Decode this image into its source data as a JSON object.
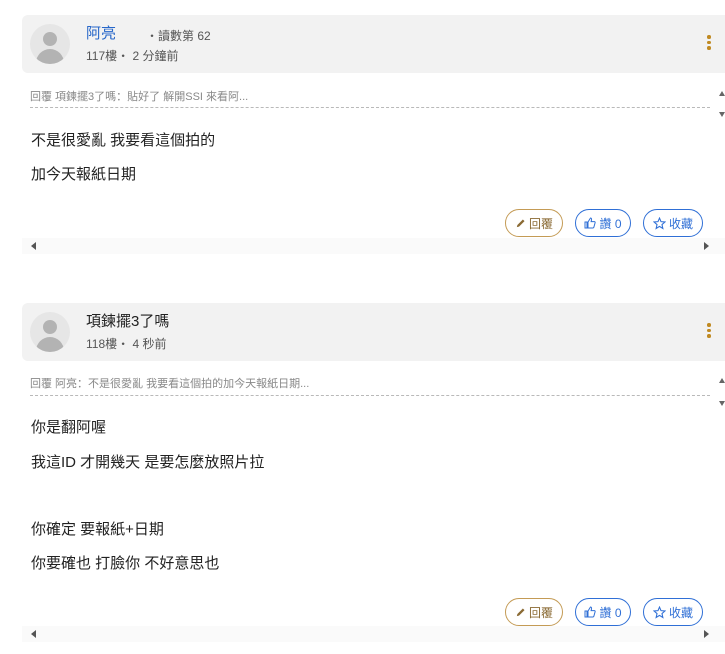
{
  "posts": [
    {
      "username": "阿亮",
      "rank": "・讀數第 62",
      "floor": "117樓・ 2 分鐘前",
      "quote": "回覆 項鍊擺3了嗎：貼好了 解開SSI 來看阿...",
      "lines": [
        "不是很愛亂 我要看這個拍的",
        "加今天報紙日期"
      ],
      "buttons": {
        "reply": "回覆",
        "like": "讚 0",
        "fav": "收藏"
      }
    },
    {
      "username": "項鍊擺3了嗎",
      "floor": "118樓・ 4 秒前",
      "quote": "回覆 阿亮：不是很愛亂 我要看這個拍的加今天報紙日期...",
      "lines": [
        "你是翻阿喔",
        "我這ID 才開幾天 是要怎麼放照片拉",
        "",
        "你確定 要報紙+日期",
        "你要確也 打臉你 不好意思也"
      ],
      "buttons": {
        "reply": "回覆",
        "like": "讚 0",
        "fav": "收藏"
      }
    }
  ],
  "colors": {
    "accent": "#2f6fd6",
    "reply": "#c49b55",
    "kebab": "#c08a22",
    "header_bg": "#f2f2f2"
  },
  "icons": [
    "kebab-menu-icon",
    "pencil-icon",
    "thumbs-up-icon",
    "star-icon"
  ]
}
